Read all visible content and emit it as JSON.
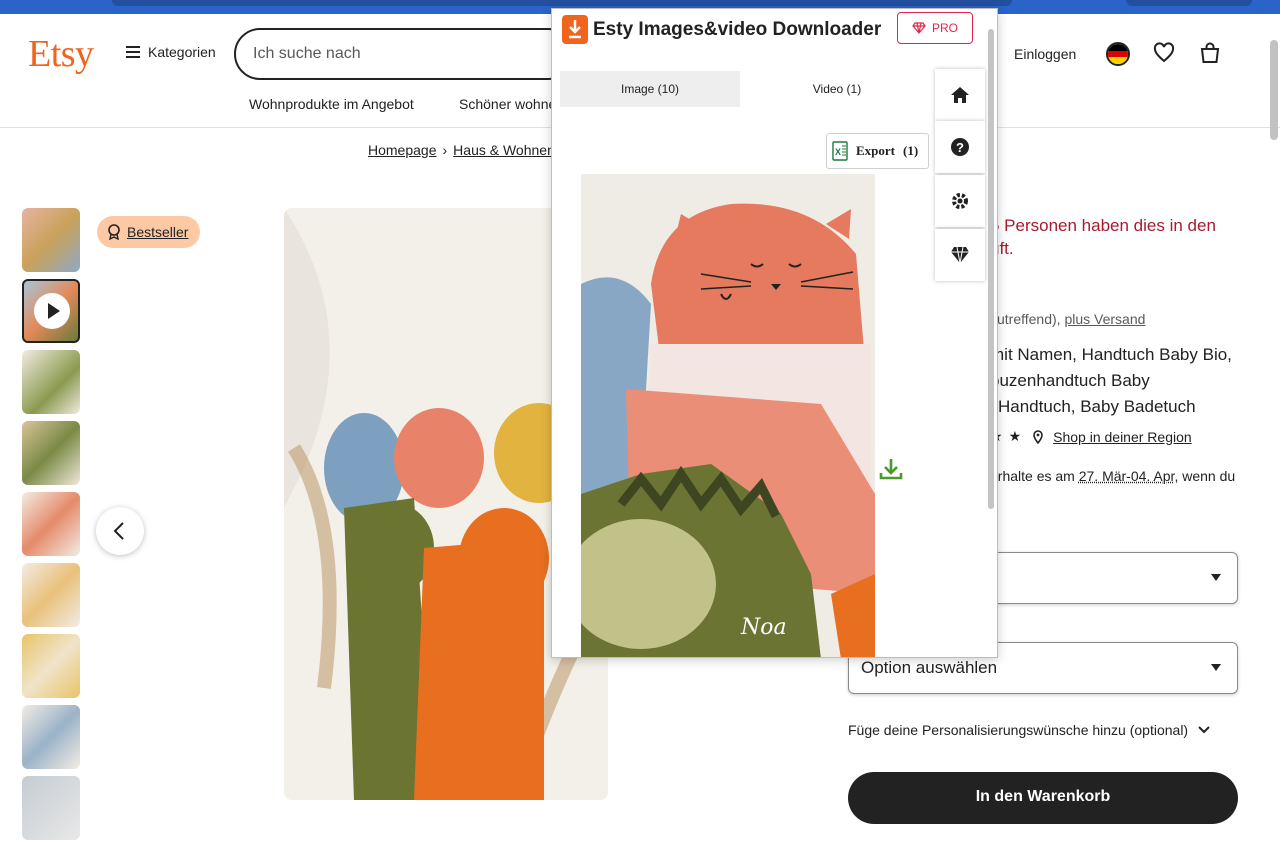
{
  "header": {
    "logo": "Etsy",
    "categories_label": "Kategorien",
    "search_placeholder": "Ich suche nach",
    "login_label": "Einloggen",
    "subnav": [
      "Wohnprodukte im Angebot",
      "Schöner wohne"
    ]
  },
  "breadcrumb": [
    "Homepage",
    "Haus & Wohnen"
  ],
  "product": {
    "bestseller_label": "Bestseller",
    "social_proof": [
      "5 Personen haben dies in den",
      "uft."
    ],
    "price_note_prefix": "zutreffend),",
    "price_note_link": "plus Versand",
    "title_lines": [
      "mit Namen, Handtuch Baby Bio,",
      "puzenhandtuch Baby",
      "Handtuch, Baby Badetuch"
    ],
    "shop_region_link": "Shop in deiner Region",
    "delivery_prefix": "erhalte es am",
    "delivery_date": "27. Mär-04. Apr",
    "delivery_suffix": ", wenn du",
    "option_placeholder": "Option auswählen",
    "personalization_label": "Füge deine Personalisierungswünsche hinzu (optional)",
    "add_to_cart": "In den Warenkorb"
  },
  "extension": {
    "title": "Esty Images&video Downloader",
    "pro_label": "PRO",
    "tab_image": "Image (10)",
    "tab_video": "Video (1)",
    "export_label": "Export",
    "export_count": "(1)"
  },
  "colors": {
    "etsy_orange": "#f1641e",
    "dark": "#222222",
    "alert_red": "#a61a2e",
    "pro_red": "#e0284a",
    "download_green": "#4a9a2a",
    "bestseller_bg": "#fcc9a4"
  },
  "icons": [
    "hamburger-icon",
    "flag-de-icon",
    "heart-icon",
    "shopping-bag-icon",
    "badge-icon",
    "chevron-left-icon",
    "play-icon",
    "location-pin-icon",
    "star-icon",
    "chevron-down-icon",
    "download-icon",
    "diamond-icon",
    "home-icon",
    "help-icon",
    "gear-icon",
    "excel-icon"
  ]
}
